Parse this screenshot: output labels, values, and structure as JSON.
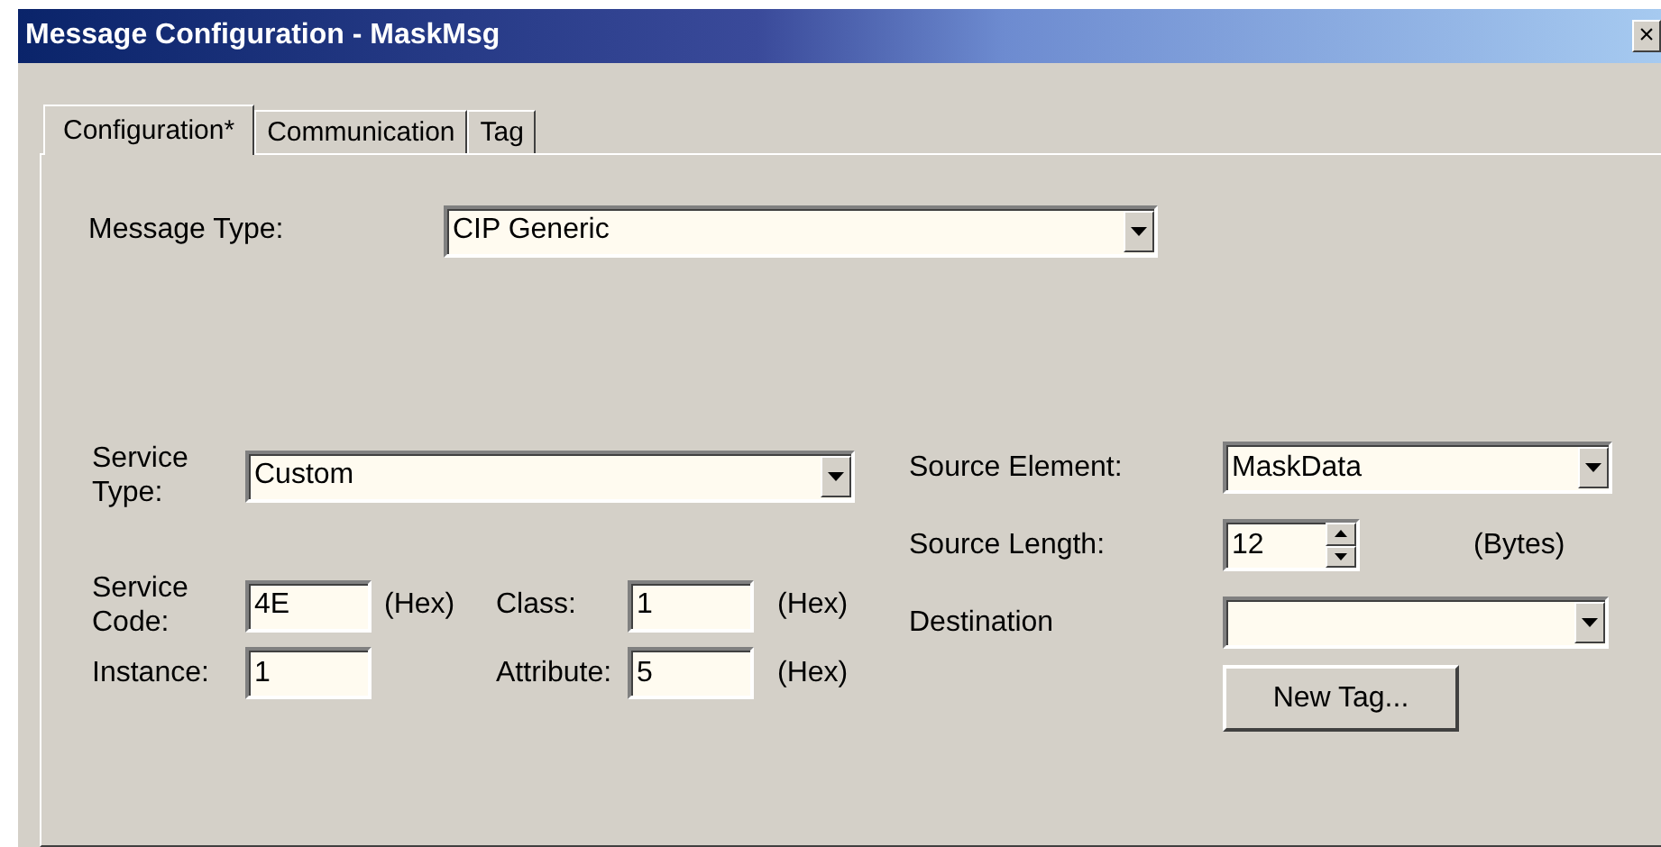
{
  "window": {
    "title": "Message Configuration - MaskMsg",
    "close": "×"
  },
  "tabs": [
    {
      "label": "Configuration*",
      "selected": true
    },
    {
      "label": "Communication",
      "selected": false
    },
    {
      "label": "Tag",
      "selected": false
    }
  ],
  "message_type": {
    "label": "Message Type:",
    "value": "CIP Generic"
  },
  "service_type": {
    "label": "Service Type:",
    "value": "Custom"
  },
  "service_code": {
    "label": "Service Code:",
    "value": "4E",
    "unit": "(Hex)"
  },
  "class": {
    "label": "Class:",
    "value": "1",
    "unit": "(Hex)"
  },
  "instance": {
    "label": "Instance:",
    "value": "1"
  },
  "attribute": {
    "label": "Attribute:",
    "value": "5",
    "unit": "(Hex)"
  },
  "source_element": {
    "label": "Source Element:",
    "value": "MaskData"
  },
  "source_length": {
    "label": "Source Length:",
    "value": "12",
    "unit": "(Bytes)"
  },
  "destination": {
    "label": "Destination"
  },
  "new_tag_button": {
    "label": "New Tag..."
  }
}
